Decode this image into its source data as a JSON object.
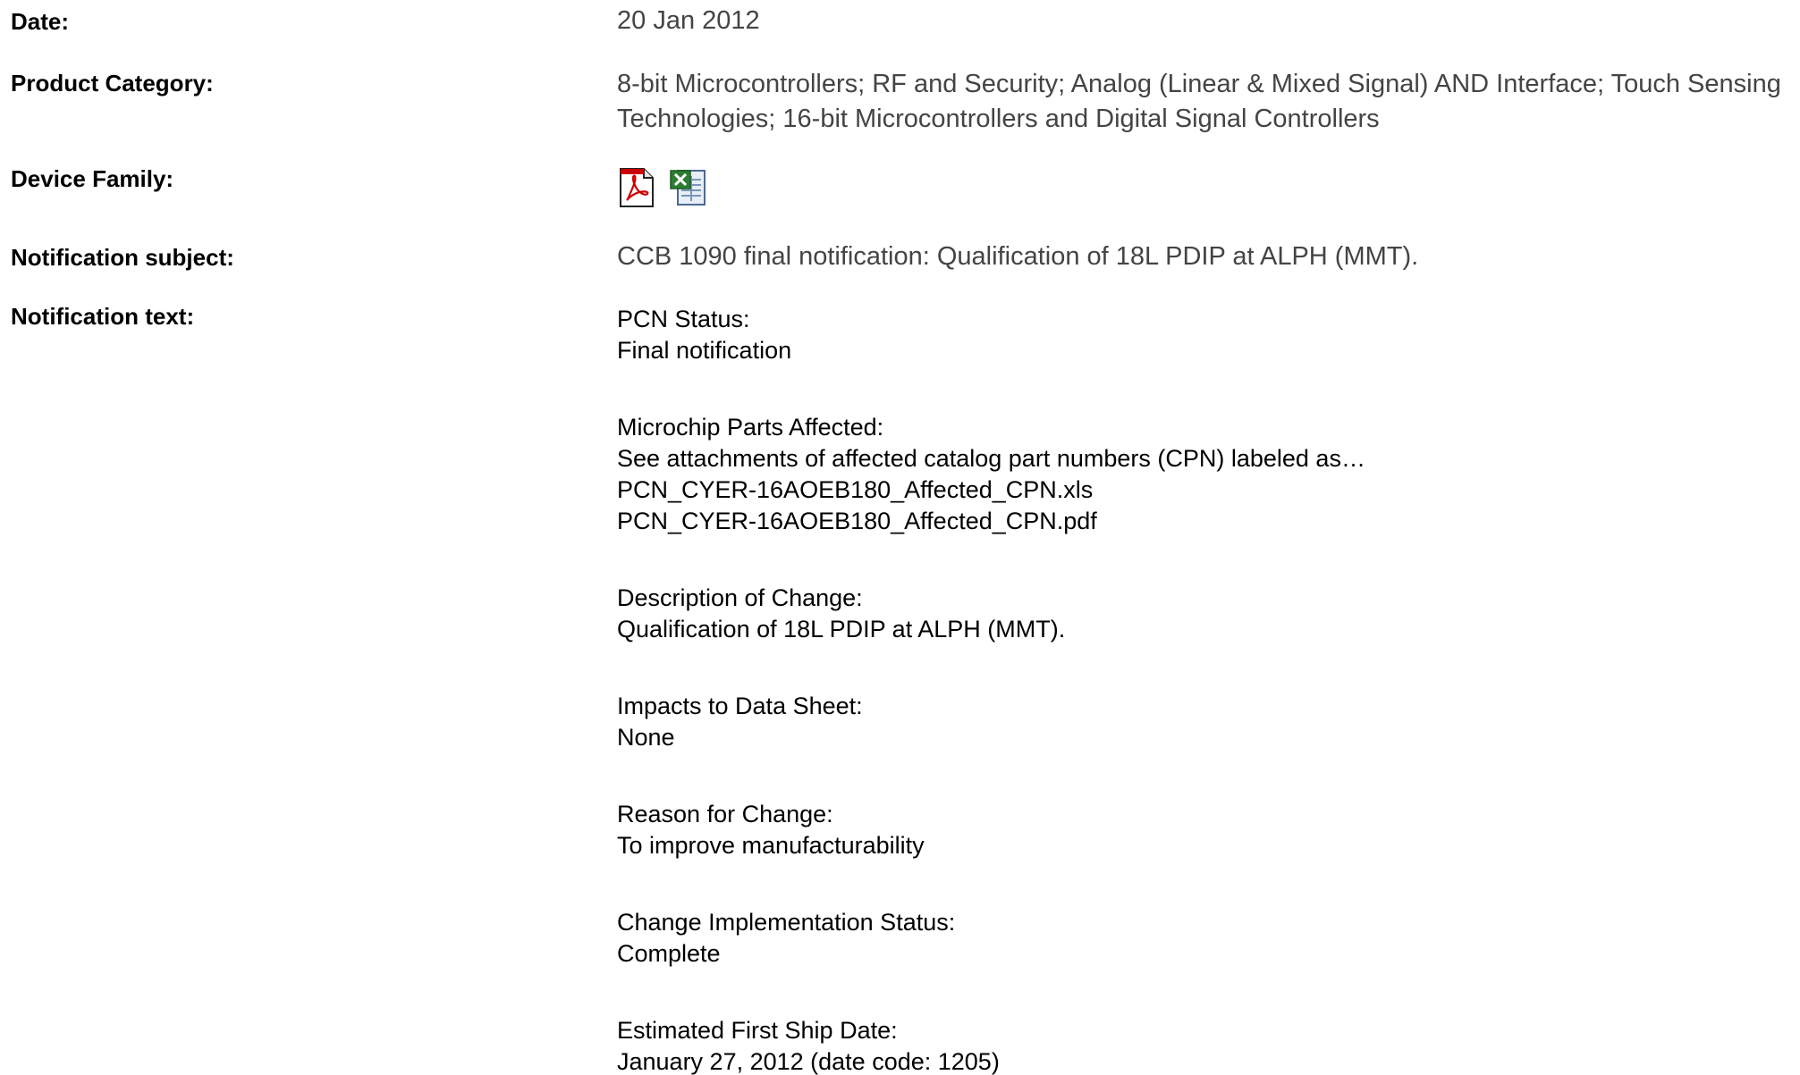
{
  "fields": {
    "date": {
      "label": "Date:",
      "value": "20 Jan 2012"
    },
    "product_category": {
      "label": "Product Category:",
      "value": "8-bit Microcontrollers; RF and Security; Analog (Linear & Mixed Signal) AND Interface; Touch Sensing Technologies; 16-bit Microcontrollers and Digital Signal Controllers"
    },
    "device_family": {
      "label": "Device Family:",
      "icons": [
        "pdf-icon",
        "excel-icon"
      ]
    },
    "notification_subject": {
      "label": "Notification subject:",
      "value": "CCB 1090 final notification: Qualification of 18L PDIP at ALPH (MMT)."
    },
    "notification_text": {
      "label": "Notification text:",
      "sections": [
        {
          "heading": "PCN Status:",
          "lines": [
            "Final notification"
          ]
        },
        {
          "heading": "Microchip Parts Affected:",
          "lines": [
            "See attachments of affected catalog part numbers (CPN) labeled as…",
            "PCN_CYER-16AOEB180_Affected_CPN.xls",
            "PCN_CYER-16AOEB180_Affected_CPN.pdf"
          ]
        },
        {
          "heading": "Description of Change:",
          "lines": [
            "Qualification of 18L PDIP at ALPH (MMT)."
          ]
        },
        {
          "heading": "Impacts to Data Sheet:",
          "lines": [
            "None"
          ]
        },
        {
          "heading": "Reason for Change:",
          "lines": [
            "To improve manufacturability"
          ]
        },
        {
          "heading": "Change Implementation Status:",
          "lines": [
            "Complete"
          ]
        },
        {
          "heading": "Estimated First Ship Date:",
          "lines": [
            "January 27, 2012 (date code: 1205)"
          ]
        }
      ]
    }
  },
  "colors": {
    "label_text": "#000000",
    "value_text": "#444444",
    "pdf_red": "#cc0000",
    "excel_green": "#2e7d32"
  }
}
